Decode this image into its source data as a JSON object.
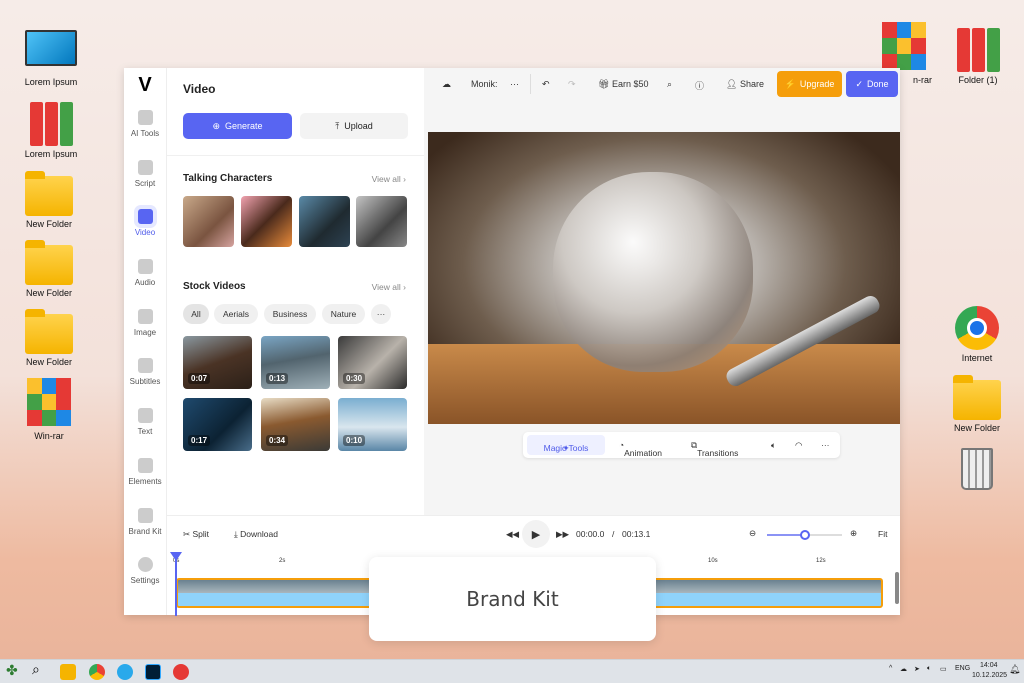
{
  "desktop": {
    "left": [
      {
        "label": "Lorem Ipsum",
        "icon": "monitor-icon"
      },
      {
        "label": "Lorem Ipsum",
        "icon": "binders-icon"
      },
      {
        "label": "New Folder",
        "icon": "folder-icon"
      },
      {
        "label": "New Folder",
        "icon": "folder-icon"
      },
      {
        "label": "New Folder",
        "icon": "folder-icon"
      },
      {
        "label": "Win-rar",
        "icon": "winrar-icon"
      }
    ],
    "right": [
      {
        "label": "n-rar",
        "icon": "winrar-icon"
      },
      {
        "label": "Folder (1)",
        "icon": "binders-icon"
      },
      {
        "label": "Internet",
        "icon": "chrome-icon"
      },
      {
        "label": "New Folder",
        "icon": "folder-icon"
      },
      {
        "label": "",
        "icon": "trash-icon"
      }
    ]
  },
  "app": {
    "logo": "V",
    "rail": [
      "AI Tools",
      "Script",
      "Video",
      "Audio",
      "Image",
      "Subtitles",
      "Text",
      "Elements",
      "Brand Kit",
      "Settings"
    ],
    "panel": {
      "title": "Video",
      "generate": "Generate",
      "upload": "Upload",
      "talking": "Talking Characters",
      "view_all": "View all",
      "stock": "Stock Videos",
      "chips": [
        "All",
        "Aerials",
        "Business",
        "Nature",
        "···"
      ],
      "durations": [
        "0:07",
        "0:13",
        "0:30",
        "0:17",
        "0:34",
        "0:10"
      ]
    },
    "topbar": {
      "project": "Monik:",
      "more": "···",
      "earn": "Earn $50",
      "share": "Share",
      "upgrade": "Upgrade",
      "done": "Done"
    },
    "tools": {
      "magic": "Magic Tools",
      "animation": "Animation",
      "transitions": "Transitions",
      "more": "···"
    },
    "bottom": {
      "split": "Split",
      "download": "Download",
      "current": "00:00.0",
      "sep": "/",
      "total": "00:13.1",
      "fit": "Fit",
      "zoom_level": 0.5,
      "ticks": [
        "0s",
        "2s",
        "10s",
        "12s"
      ]
    }
  },
  "popup": {
    "title": "Brand Kit"
  },
  "taskbar": {
    "lang": "ENG",
    "time": "14:04",
    "date": "10.12.2025"
  },
  "colors": {
    "accent": "#5865f2",
    "upgrade": "#f59e0b"
  }
}
